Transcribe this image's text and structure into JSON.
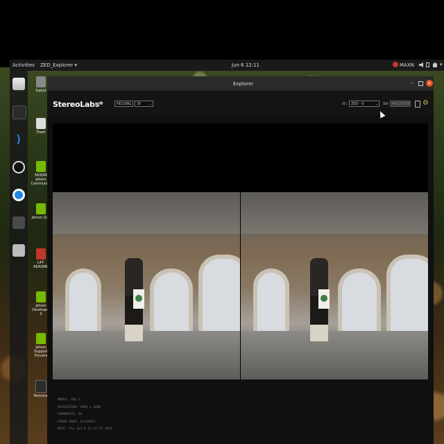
{
  "topbar": {
    "activities": "Activities",
    "app_menu": "ZED_Explorer ▾",
    "clock": "Jun 6  12:11",
    "power_mode": "MAXN"
  },
  "desktop_icons": [
    {
      "label": "frpbot"
    },
    {
      "label": "Trash"
    },
    {
      "label": "NVIDIA Jetson Community"
    },
    {
      "label": "Jetson Zoo"
    },
    {
      "label": "L4T-README"
    },
    {
      "label": "Jetson Developer Z"
    },
    {
      "label": "Jetson Support Forums"
    },
    {
      "label": "Terminal"
    }
  ],
  "window": {
    "title": "Explorer",
    "brand": "StereoLabs*",
    "live": "LIVE",
    "resolution_option": "HD1080",
    "fps_option": "30",
    "sn_label": "SN:",
    "sn_value": "4A123000",
    "id_label": "ID:",
    "id_option": "ZED  -  0"
  },
  "camera_info": {
    "model": "MODEL: ZED 2",
    "resolution": "RESOLUTION: 3840 x 1080",
    "framerate": "FRAMERATE: 30",
    "frame_drop": "FRAME DROP: 0/125433",
    "date": "DATE: Thu Jun 6 12:11:37 2024"
  },
  "colors": {
    "accent_close": "#e95420",
    "panel_bg": "#101010"
  }
}
